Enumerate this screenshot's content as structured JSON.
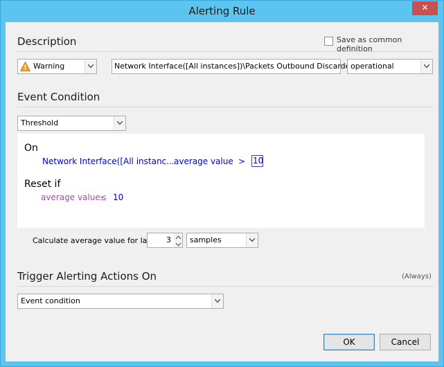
{
  "window": {
    "title": "Alerting Rule",
    "close_glyph": "✕"
  },
  "description": {
    "heading": "Description",
    "save_common_label": "Save as common definition",
    "severity": {
      "value": "Warning",
      "icon": "warning-icon"
    },
    "counter_path": "Network Interface([All instances])\\Packets Outbound Discarded",
    "state": "operational"
  },
  "event_condition": {
    "heading": "Event Condition",
    "type": "Threshold",
    "on_label": "On",
    "counter_short": "Network Interface([All instanc...",
    "aggregate": "average value",
    "operator": ">",
    "threshold": "10",
    "reset_label": "Reset if",
    "reset_aggregate": "average value",
    "reset_operator": "≤",
    "reset_value": "10",
    "calc_label": "Calculate average value for last",
    "samples_count": "3",
    "samples_unit": "samples"
  },
  "trigger": {
    "heading": "Trigger Alerting Actions On",
    "note": "(Always)",
    "value": "Event condition"
  },
  "buttons": {
    "ok": "OK",
    "cancel": "Cancel"
  },
  "colors": {
    "frame": "#5cc4ef",
    "link_blue": "#0000cc",
    "reset_purple": "#9b50a8",
    "close_red": "#c75050"
  }
}
